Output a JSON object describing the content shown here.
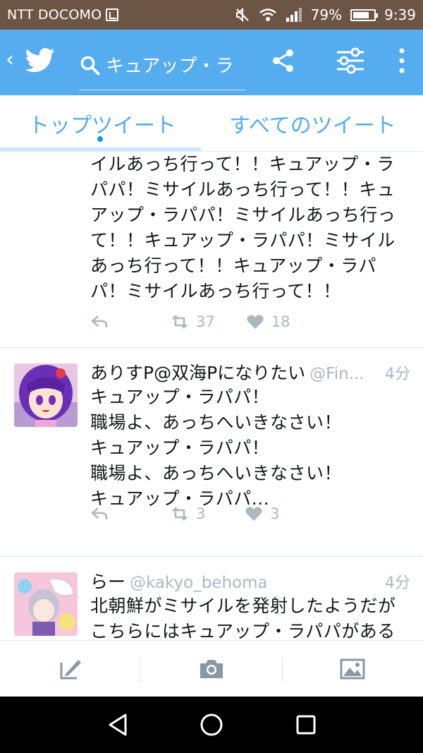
{
  "status_bar": {
    "carrier": "NTT DOCOMO",
    "battery": "79%",
    "battery_level": 0.79,
    "time": "9:39"
  },
  "app_bar": {
    "back_label": "‹",
    "search_query": "キュアップ・ラ"
  },
  "tabs": [
    {
      "label": "トップツイート",
      "active": true
    },
    {
      "label": "すべてのツイート",
      "active": false
    }
  ],
  "tweets": [
    {
      "text": "イルあっち行って！！キュアップ・ラ\nパパ！ミサイルあっち行って！！キュ\nアップ・ラパパ！ミサイルあっち行っ\nて！！キュアップ・ラパパ！ミサイル\nあっち行って！！キュアップ・ラパ\nパ！ミサイルあっち行って！！",
      "retweets": "37",
      "likes": "18"
    },
    {
      "name": "ありすP@双海Pになりたい",
      "handle": "@Fin...",
      "time": "4分",
      "text": "キュアップ・ラパパ！\n職場よ、あっちへいきなさい！\nキュアップ・ラパパ！\n職場よ、あっちへいきなさい！\nキュアップ・ラパパ...",
      "retweets": "3",
      "likes": "3"
    },
    {
      "name": "らー",
      "handle": "@kakyo_behoma",
      "time": "4分",
      "text": "北朝鮮がミサイルを発射したようだが\nこちらにはキュアップ・ラパパがある"
    }
  ],
  "colors": {
    "status_bar": "#6d5546",
    "app_bar": "#55acee",
    "accent": "#1b95e0",
    "muted": "#aab8c2"
  }
}
